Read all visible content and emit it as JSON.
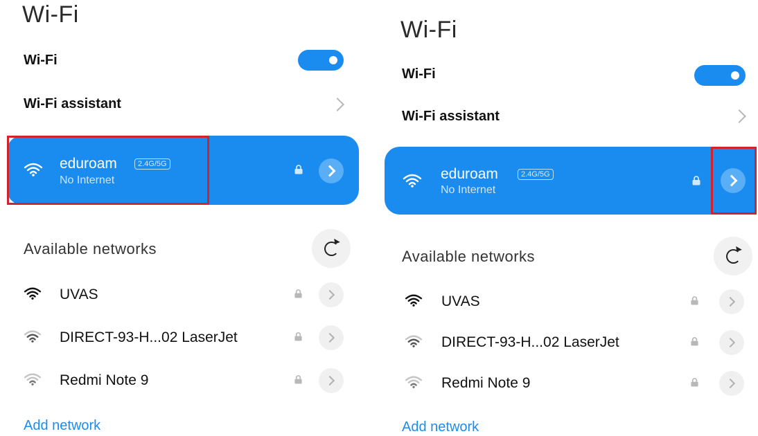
{
  "screens": [
    {
      "title": "Wi-Fi",
      "wifi_label": "Wi-Fi",
      "wifi_enabled": true,
      "assistant_label": "Wi-Fi assistant",
      "connected": {
        "ssid": "eduroam",
        "band": "2.4G/5G",
        "status": "No Internet"
      },
      "available_header": "Available networks",
      "networks": [
        {
          "name": "UVAS",
          "signal": "strong",
          "secured": true
        },
        {
          "name": "DIRECT-93-H...02 LaserJet",
          "signal": "medium",
          "secured": true
        },
        {
          "name": "Redmi Note 9",
          "signal": "weak",
          "secured": true
        }
      ],
      "add_network": "Add network",
      "highlight": "connected-network-card"
    },
    {
      "title": "Wi-Fi",
      "wifi_label": "Wi-Fi",
      "wifi_enabled": true,
      "assistant_label": "Wi-Fi assistant",
      "connected": {
        "ssid": "eduroam",
        "band": "2.4G/5G",
        "status": "No Internet"
      },
      "available_header": "Available networks",
      "networks": [
        {
          "name": "UVAS",
          "signal": "strong",
          "secured": true
        },
        {
          "name": "DIRECT-93-H...02 LaserJet",
          "signal": "medium",
          "secured": true
        },
        {
          "name": "Redmi Note 9",
          "signal": "weak",
          "secured": true
        }
      ],
      "add_network": "Add network",
      "highlight": "network-details-button"
    }
  ],
  "colors": {
    "accent": "#1a8cf0",
    "highlight_box": "#d0232b"
  },
  "icons": {
    "wifi": "wifi-signal-icon",
    "lock": "lock-icon",
    "chevron": "chevron-right-icon",
    "refresh": "refresh-icon"
  }
}
